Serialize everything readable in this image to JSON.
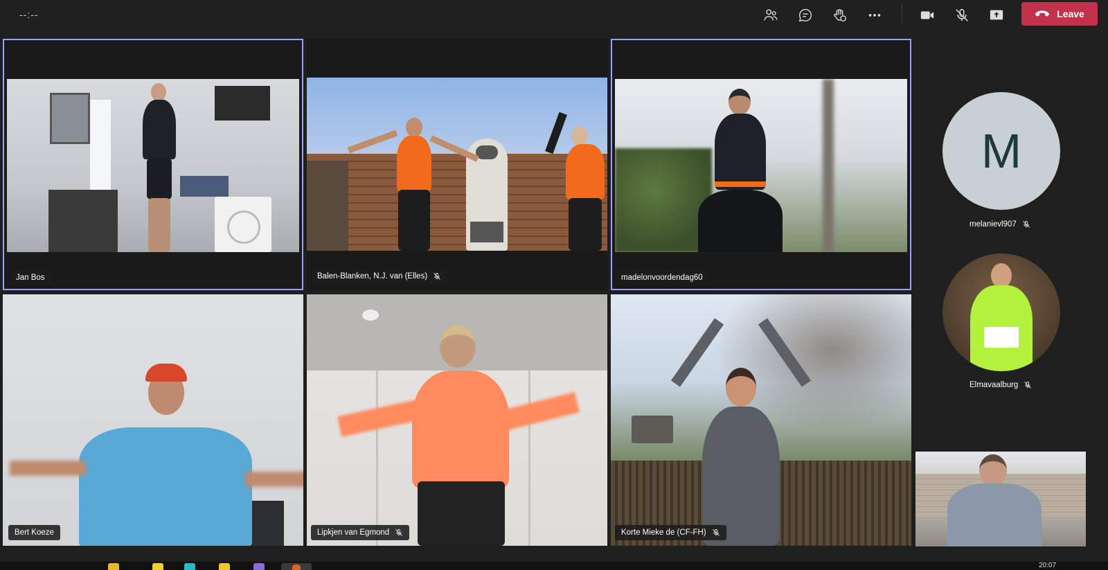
{
  "topbar": {
    "timer": "--:--",
    "leave_label": "Leave"
  },
  "colors": {
    "accent_border": "#9ea2ff",
    "leave_red": "#c4314b",
    "background": "#1f1f1f"
  },
  "tiles": [
    {
      "name": "Jan Bos",
      "muted": false,
      "active": true
    },
    {
      "name": "Balen-Blanken, N.J. van (Elles)",
      "muted": true,
      "active": false
    },
    {
      "name": "madelonvoordendag60",
      "muted": false,
      "active": true
    },
    {
      "name": "Bert Koeze",
      "muted": false,
      "active": false
    },
    {
      "name": "Lipkjen van Egmond",
      "muted": true,
      "active": false
    },
    {
      "name": "Korte Mieke de (CF-FH)",
      "muted": true,
      "active": false
    }
  ],
  "rail": {
    "participants": [
      {
        "name": "melanievl907",
        "initial": "M",
        "muted": true
      },
      {
        "name": "Elmavaalburg",
        "muted": true
      }
    ]
  },
  "taskbar": {
    "clock": "20:07"
  }
}
